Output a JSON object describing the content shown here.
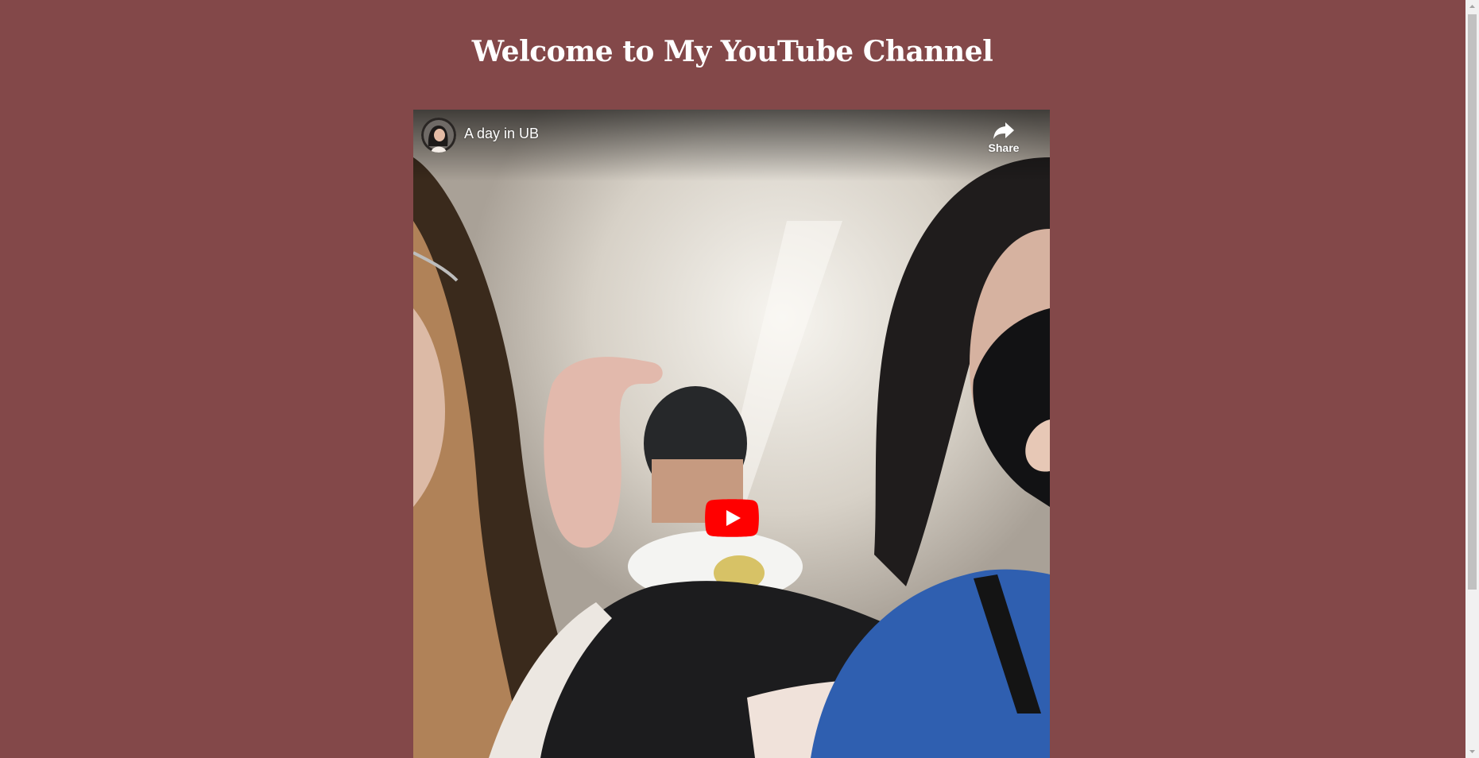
{
  "page": {
    "title": "Welcome to My YouTube Channel"
  },
  "video": {
    "title": "A day in UB",
    "share_label": "Share",
    "icons": {
      "avatar": "channel-avatar",
      "share": "share-arrow-icon",
      "play": "youtube-play-icon"
    }
  },
  "colors": {
    "background": "#834849",
    "title_text": "#ffffff",
    "play_button": "#ff0000"
  }
}
